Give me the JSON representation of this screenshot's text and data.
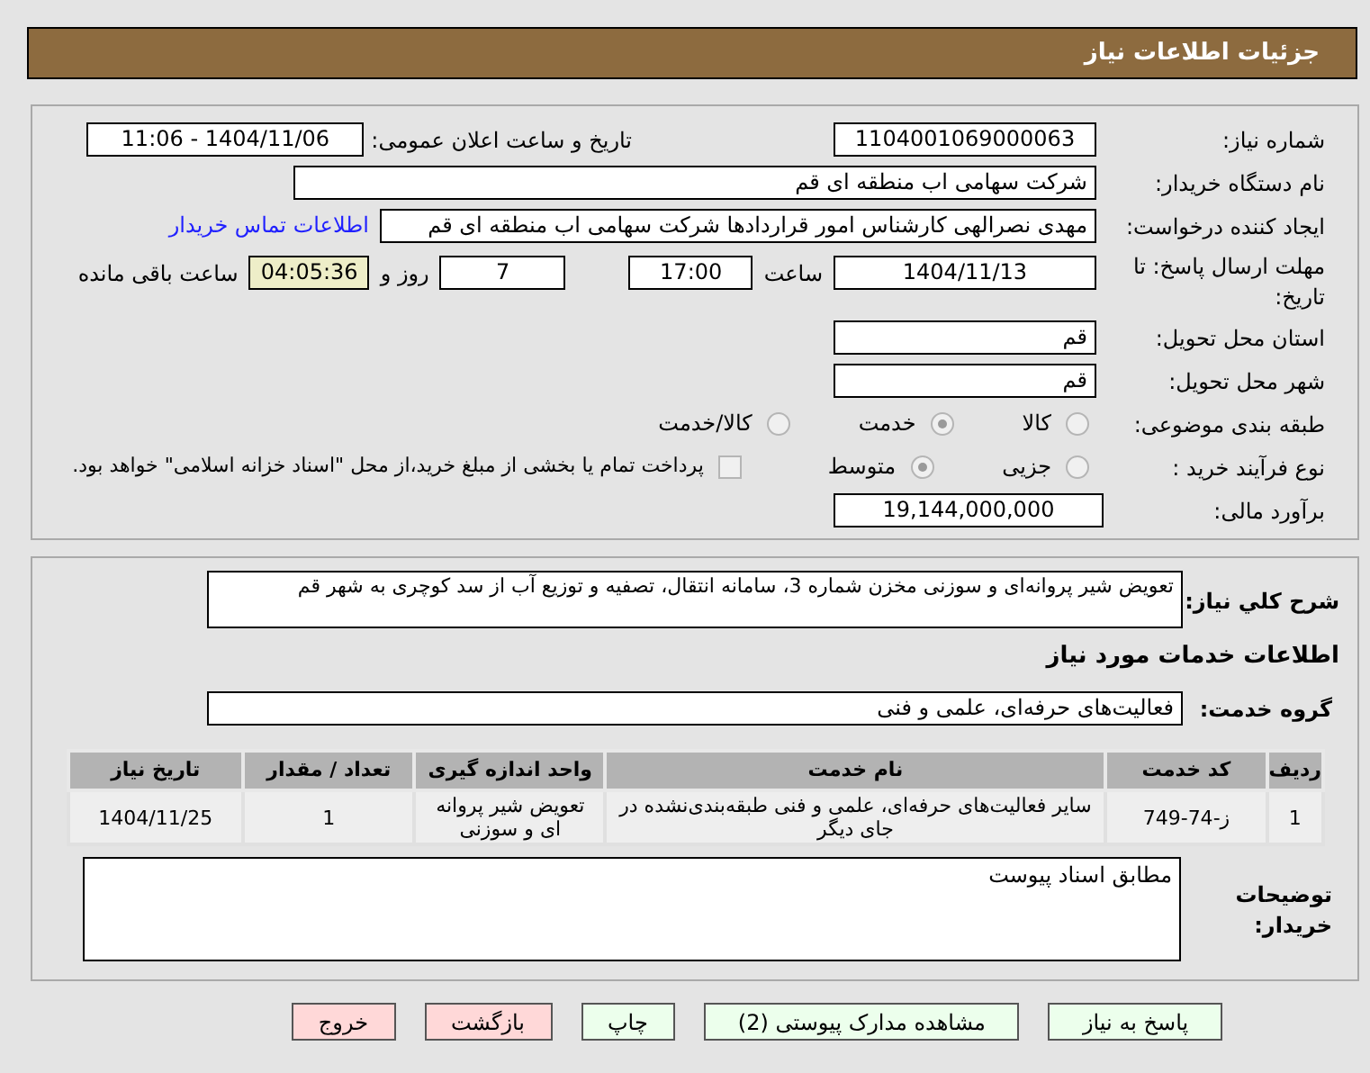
{
  "header": {
    "title": "جزئیات اطلاعات نیاز"
  },
  "need_number": {
    "label": "شماره نیاز:",
    "value": "1104001069000063"
  },
  "announce": {
    "label": "تاریخ و ساعت اعلان عمومی:",
    "value": "1404/11/06 - 11:06"
  },
  "buyer_org": {
    "label": "نام دستگاه خریدار:",
    "value": "شرکت سهامی اب منطقه ای قم"
  },
  "creator": {
    "label": "ایجاد کننده درخواست:",
    "value": "مهدی نصرالهی کارشناس امور قراردادها شرکت سهامی اب منطقه ای قم",
    "link": "اطلاعات تماس خریدار"
  },
  "deadline": {
    "label": "مهلت ارسال پاسخ: تا تاریخ:",
    "date": "1404/11/13",
    "time_label": "ساعت",
    "time": "17:00",
    "days": "7",
    "days_label": "روز و",
    "remaining": "04:05:36",
    "remaining_label": "ساعت باقی مانده"
  },
  "province": {
    "label": "استان محل تحویل:",
    "value": "قم"
  },
  "city": {
    "label": "شهر محل تحویل:",
    "value": "قم"
  },
  "category": {
    "label": "طبقه بندی موضوعی:",
    "options": [
      {
        "label": "کالا",
        "selected": false
      },
      {
        "label": "خدمت",
        "selected": true
      },
      {
        "label": "کالا/خدمت",
        "selected": false
      }
    ]
  },
  "process": {
    "label": "نوع فرآیند خرید :",
    "options": [
      {
        "label": "جزیی",
        "selected": false
      },
      {
        "label": "متوسط",
        "selected": true
      }
    ],
    "payment": {
      "label": "پرداخت تمام یا بخشی از مبلغ خرید،از محل \"اسناد خزانه اسلامی\" خواهد بود.",
      "checked": false
    }
  },
  "estimate": {
    "label": "برآورد مالی:",
    "value": "19,144,000,000"
  },
  "description": {
    "label": "شرح کلي نیاز:",
    "value": "تعویض شیر پروانه‌ای و سوزنی مخزن شماره 3، سامانه انتقال، تصفیه و توزیع آب از سد کوچری به شهر قم"
  },
  "services_heading": "اطلاعات خدمات مورد نیاز",
  "service_group": {
    "label": "گروه خدمت:",
    "value": "فعالیت‌های حرفه‌ای، علمی و فنی"
  },
  "table": {
    "columns": [
      "ردیف",
      "کد خدمت",
      "نام خدمت",
      "واحد اندازه گیری",
      "تعداد / مقدار",
      "تاریخ نیاز"
    ],
    "rows": [
      [
        "1",
        "ز-74-749",
        "سایر فعالیت‌های حرفه‌ای، علمی و فنی طبقه‌بندی‌نشده در جای دیگر",
        "تعویض شیر پروانه ای و سوزنی",
        "1",
        "1404/11/25"
      ]
    ]
  },
  "buyer_notes": {
    "label": "توضیحات خریدار:",
    "value": "مطابق اسناد پیوست"
  },
  "buttons": [
    {
      "label": "پاسخ به نیاز",
      "kind": "normal"
    },
    {
      "label": "مشاهده مدارک پیوستی (2)",
      "kind": "normal"
    },
    {
      "label": "چاپ",
      "kind": "normal"
    },
    {
      "label": "بازگشت",
      "kind": "danger"
    },
    {
      "label": "خروج",
      "kind": "danger"
    }
  ]
}
